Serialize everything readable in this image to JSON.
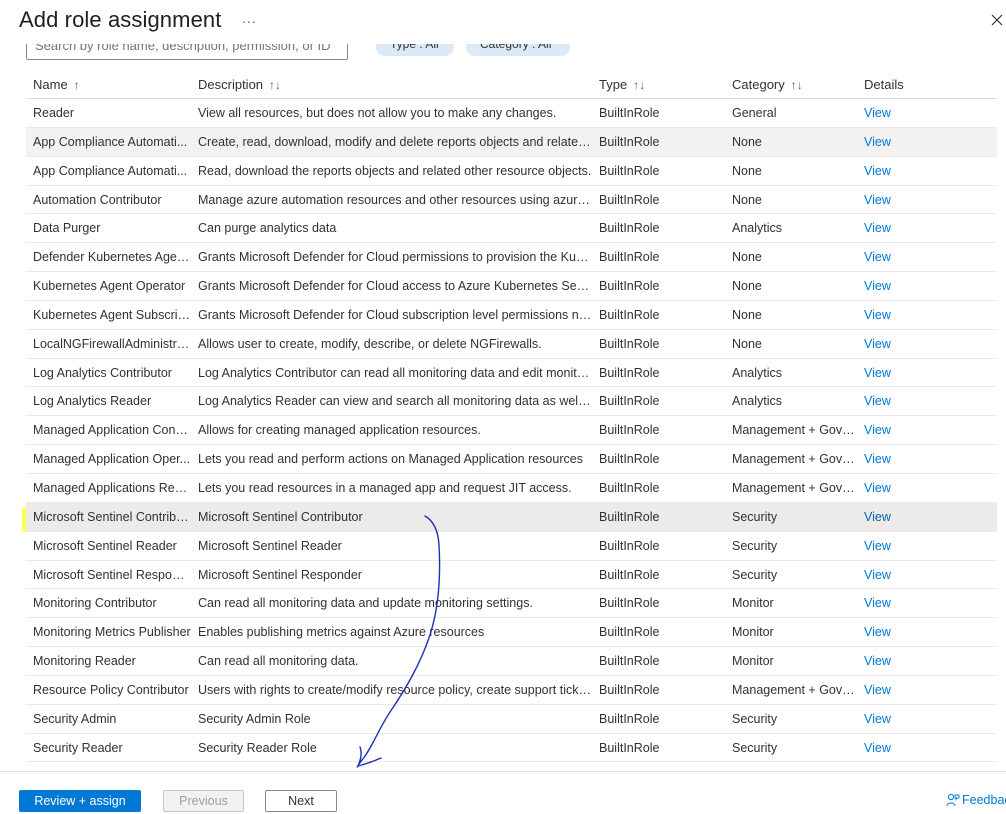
{
  "title": "Add role assignment",
  "more_label": "...",
  "filters": {
    "search_placeholder": "Search by role name, description, permission, or ID",
    "type_pill": "Type : All",
    "category_pill": "Category : All"
  },
  "table": {
    "headers": {
      "name": "Name",
      "description": "Description",
      "type": "Type",
      "category": "Category",
      "details": "Details"
    },
    "rows": [
      {
        "name": "Reader",
        "description": "View all resources, but does not allow you to make any changes.",
        "type": "BuiltInRole",
        "category": "General",
        "details": "View"
      },
      {
        "name": "App Compliance Automati...",
        "description": "Create, read, download, modify and delete reports objects and related ot...",
        "type": "BuiltInRole",
        "category": "None",
        "details": "View"
      },
      {
        "name": "App Compliance Automati...",
        "description": "Read, download the reports objects and related other resource objects.",
        "type": "BuiltInRole",
        "category": "None",
        "details": "View"
      },
      {
        "name": "Automation Contributor",
        "description": "Manage azure automation resources and other resources using azure aut...",
        "type": "BuiltInRole",
        "category": "None",
        "details": "View"
      },
      {
        "name": "Data Purger",
        "description": "Can purge analytics data",
        "type": "BuiltInRole",
        "category": "Analytics",
        "details": "View"
      },
      {
        "name": "Defender Kubernetes Agent ...",
        "description": "Grants Microsoft Defender for Cloud permissions to provision the Kubern...",
        "type": "BuiltInRole",
        "category": "None",
        "details": "View"
      },
      {
        "name": "Kubernetes Agent Operator",
        "description": "Grants Microsoft Defender for Cloud access to Azure Kubernetes Services",
        "type": "BuiltInRole",
        "category": "None",
        "details": "View"
      },
      {
        "name": "Kubernetes Agent Subscript...",
        "description": "Grants Microsoft Defender for Cloud subscription level permissions need...",
        "type": "BuiltInRole",
        "category": "None",
        "details": "View"
      },
      {
        "name": "LocalNGFirewallAdministrat...",
        "description": "Allows user to create, modify, describe, or delete NGFirewalls.",
        "type": "BuiltInRole",
        "category": "None",
        "details": "View"
      },
      {
        "name": "Log Analytics Contributor",
        "description": "Log Analytics Contributor can read all monitoring data and edit monitori...",
        "type": "BuiltInRole",
        "category": "Analytics",
        "details": "View"
      },
      {
        "name": "Log Analytics Reader",
        "description": "Log Analytics Reader can view and search all monitoring data as well as a...",
        "type": "BuiltInRole",
        "category": "Analytics",
        "details": "View"
      },
      {
        "name": "Managed Application Contr...",
        "description": "Allows for creating managed application resources.",
        "type": "BuiltInRole",
        "category": "Management + Gover...",
        "details": "View"
      },
      {
        "name": "Managed Application Oper...",
        "description": "Lets you read and perform actions on Managed Application resources",
        "type": "BuiltInRole",
        "category": "Management + Gover...",
        "details": "View"
      },
      {
        "name": "Managed Applications Read...",
        "description": "Lets you read resources in a managed app and request JIT access.",
        "type": "BuiltInRole",
        "category": "Management + Gover...",
        "details": "View"
      },
      {
        "name": "Microsoft Sentinel Contribu...",
        "description": "Microsoft Sentinel Contributor",
        "type": "BuiltInRole",
        "category": "Security",
        "details": "View"
      },
      {
        "name": "Microsoft Sentinel Reader",
        "description": "Microsoft Sentinel Reader",
        "type": "BuiltInRole",
        "category": "Security",
        "details": "View"
      },
      {
        "name": "Microsoft Sentinel Responder",
        "description": "Microsoft Sentinel Responder",
        "type": "BuiltInRole",
        "category": "Security",
        "details": "View"
      },
      {
        "name": "Monitoring Contributor",
        "description": "Can read all monitoring data and update monitoring settings.",
        "type": "BuiltInRole",
        "category": "Monitor",
        "details": "View"
      },
      {
        "name": "Monitoring Metrics Publisher",
        "description": "Enables publishing metrics against Azure resources",
        "type": "BuiltInRole",
        "category": "Monitor",
        "details": "View"
      },
      {
        "name": "Monitoring Reader",
        "description": "Can read all monitoring data.",
        "type": "BuiltInRole",
        "category": "Monitor",
        "details": "View"
      },
      {
        "name": "Resource Policy Contributor",
        "description": "Users with rights to create/modify resource policy, create support ticket a...",
        "type": "BuiltInRole",
        "category": "Management + Gover...",
        "details": "View"
      },
      {
        "name": "Security Admin",
        "description": "Security Admin Role",
        "type": "BuiltInRole",
        "category": "Security",
        "details": "View"
      },
      {
        "name": "Security Reader",
        "description": "Security Reader Role",
        "type": "BuiltInRole",
        "category": "Security",
        "details": "View"
      }
    ],
    "selected_row": 14,
    "hovered_row": 1
  },
  "footer": {
    "review_assign": "Review + assign",
    "previous": "Previous",
    "next": "Next",
    "feedback": "Feedback"
  },
  "colors": {
    "accent": "#0078d4",
    "highlighter": "#ffff3a",
    "ink": "#1f2fb8"
  },
  "icons": {
    "more": "ellipsis-icon",
    "close": "close-icon",
    "sort": "sort-arrows-icon",
    "feedback": "feedback-person-icon"
  }
}
